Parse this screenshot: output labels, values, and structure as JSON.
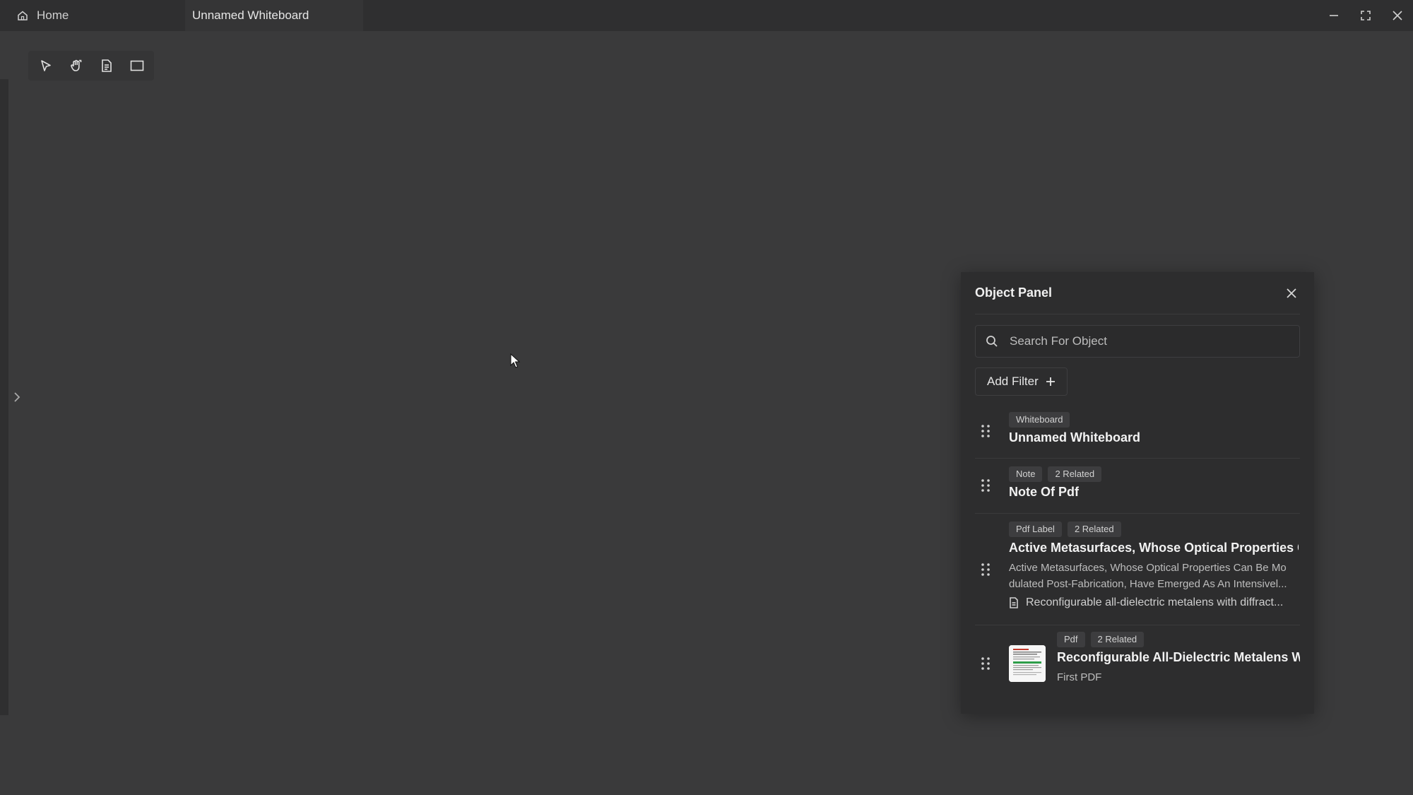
{
  "titlebar": {
    "home_label": "Home",
    "active_tab": "Unnamed Whiteboard"
  },
  "toolbar": {
    "tools": [
      "select-icon",
      "hand-pan-icon",
      "note-icon",
      "frame-icon"
    ]
  },
  "panel": {
    "title": "Object Panel",
    "search_placeholder": "Search For Object",
    "add_filter_label": "Add Filter",
    "items": [
      {
        "badges": [
          "Whiteboard"
        ],
        "title": "Unnamed Whiteboard"
      },
      {
        "badges": [
          "Note",
          "2 Related"
        ],
        "title": "Note Of Pdf"
      },
      {
        "badges": [
          "Pdf Label",
          "2 Related"
        ],
        "title": "Active Metasurfaces, Whose Optical Properties C...",
        "description": "Active Metasurfaces, Whose Optical Properties Can Be Mo dulated Post-Fabrication, Have Emerged As An Intensivel...",
        "source": "Reconfigurable all-dielectric metalens with diffract..."
      },
      {
        "badges": [
          "Pdf",
          "2 Related"
        ],
        "title": "Reconfigurable All-Dielectric Metalens Wi...",
        "subtitle": "First PDF"
      }
    ]
  }
}
